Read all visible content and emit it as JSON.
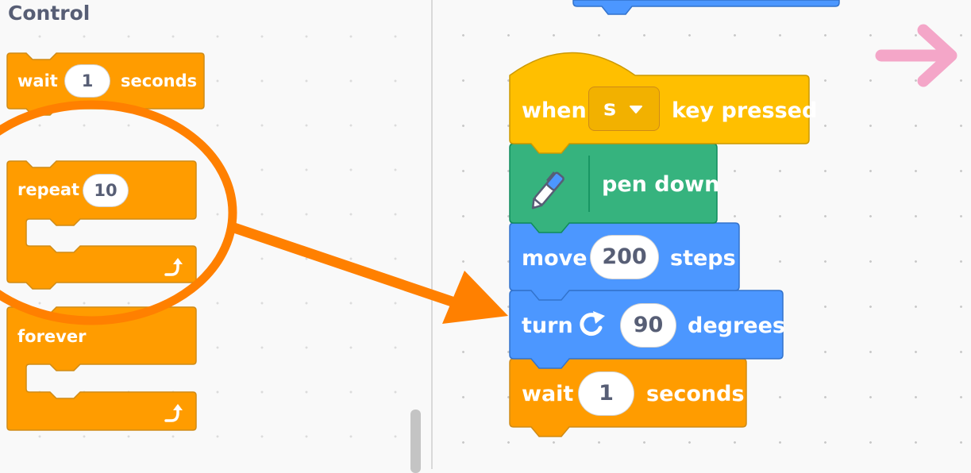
{
  "palette": {
    "category": "Control",
    "wait_block": {
      "label": "wait",
      "value": "1",
      "suffix": "seconds"
    },
    "repeat_block": {
      "label": "repeat",
      "value": "10"
    },
    "forever_block": {
      "label": "forever"
    }
  },
  "script": {
    "hat_block": {
      "label": "when",
      "key": "s",
      "suffix": "key pressed"
    },
    "pen_block": {
      "label": "pen down"
    },
    "move_block": {
      "label": "move",
      "value": "200",
      "suffix": "steps"
    },
    "turn_block": {
      "label": "turn",
      "value": "90",
      "suffix": "degrees"
    },
    "wait_block": {
      "label": "wait",
      "value": "1",
      "suffix": "seconds"
    }
  },
  "colors": {
    "control": "#ff9c00",
    "control_border": "#cf8b17",
    "events": "#ffbf00",
    "pen": "#36b37e",
    "motion": "#4c97ff",
    "annotation_orange": "#ff8000",
    "annotation_pink": "#f4a6c8"
  },
  "icons": [
    "pen-icon",
    "turn-right-icon",
    "loop-arrow-icon",
    "dropdown-caret-icon"
  ]
}
